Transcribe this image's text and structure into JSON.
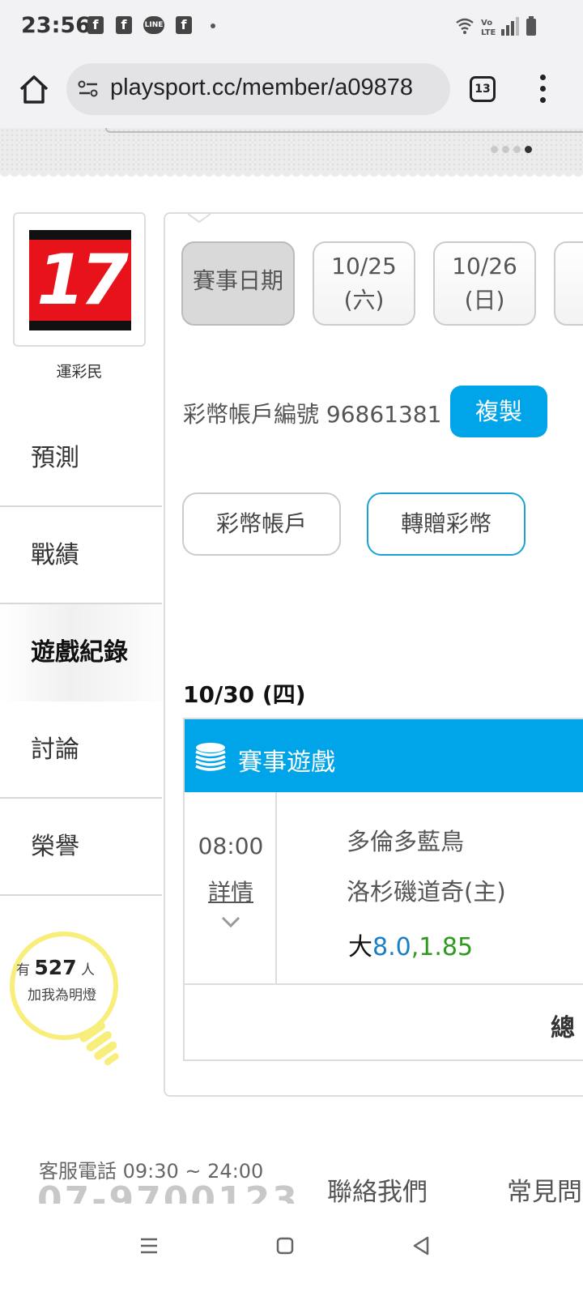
{
  "status_bar": {
    "time": "23:56",
    "notif_icons": [
      "facebook-icon",
      "facebook-icon",
      "line-icon",
      "facebook-icon"
    ],
    "line_label": "LINE"
  },
  "browser": {
    "url": "playsport.cc/member/a09878",
    "tab_count": "13"
  },
  "profile": {
    "username": "運彩民",
    "logo_text": "17"
  },
  "sidebar": {
    "items": [
      {
        "label": "預測"
      },
      {
        "label": "戰績"
      },
      {
        "label": "遊戲紀錄"
      },
      {
        "label": "討論"
      },
      {
        "label": "榮譽"
      }
    ],
    "active_index": 2
  },
  "fans": {
    "prefix": "有",
    "count": "527",
    "suffix": "人",
    "line2": "加我為明燈"
  },
  "date_tabs": [
    {
      "label": "賽事日期"
    },
    {
      "line1": "10/25",
      "line2": "(六)"
    },
    {
      "line1": "10/26",
      "line2": "(日)"
    }
  ],
  "account": {
    "label": "彩幣帳戶編號 96861381",
    "copy_label": "複製"
  },
  "actions": {
    "account_button": "彩幣帳戶",
    "transfer_button": "轉贈彩幣"
  },
  "game_day": {
    "title": "10/30 (四)"
  },
  "game_section": {
    "header": "賽事遊戲",
    "time": "08:00",
    "detail": "詳情",
    "team_away": "多倫多藍鳥",
    "team_home": "洛杉磯道奇(主)",
    "pick_side": "大",
    "pick_line": "8.0",
    "pick_sep": ",",
    "pick_odds": "1.85",
    "total_label": "總"
  },
  "footer": {
    "service_hours": "客服電話 09:30 ~ 24:00",
    "phone": "07-9700123",
    "contact": "聯絡我們",
    "faq": "常見問"
  },
  "colors": {
    "accent": "#00a4e8",
    "odds_blue": "#1a7fc4",
    "odds_green": "#2e9a1e",
    "bulb": "#f7ee7b",
    "logo_red": "#e8131a"
  }
}
